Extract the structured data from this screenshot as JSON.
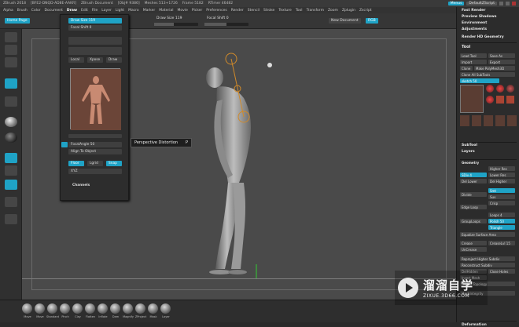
{
  "titlebar": {
    "items": [
      "ZBrush 2018",
      "[BFE2-DNQD-AD8E-AAKR]",
      "ZBrush Document",
      "[Obj# 9386]",
      "Meshes 513+1726",
      "Frame 5182",
      "RTimer 46482"
    ],
    "menus_btn": "Menus",
    "script_label": "DefaultZScript"
  },
  "menubar": {
    "items": [
      "Alpha",
      "Brush",
      "Color",
      "Document",
      "Draw",
      "Edit",
      "File",
      "Layer",
      "Light",
      "Macro",
      "Marker",
      "Material",
      "Movie",
      "Picker",
      "Preferences",
      "Render",
      "Stencil",
      "Stroke",
      "Texture",
      "Tool",
      "Transform",
      "Zoom",
      "Zplugin",
      "Zscript"
    ],
    "active": "Draw"
  },
  "topbar": {
    "home": "Home Page",
    "draw_size": "Draw Size 119",
    "focal_shift": "Focal Shift 0",
    "draw_size_2": "Draw Size 119",
    "focal_shift_2": "Focal Shift 0",
    "new_document": "New Document",
    "rgb_btn": "RGB"
  },
  "popup": {
    "draw_size": "Draw Size 119",
    "focal_shift": "Focal Shift 0",
    "xyz": "XYZ",
    "perspective_label": "Persp",
    "focal_angle": "FocalAngle 50",
    "align_to_object": "Align To Object",
    "floor": "Floor",
    "channels": "Channels",
    "buttons": [
      "Local",
      "Xpose",
      "Draw",
      "Lgrid",
      "Snap"
    ]
  },
  "tooltip": {
    "label": "Perspective Distortion",
    "shortcut": "P"
  },
  "rightpanel": {
    "sections": [
      "Fast Render",
      "Preview Shadows",
      "Environment",
      "Adjustments",
      "Render HD Geometry"
    ],
    "tool_title": "Tool",
    "load_tool": "Load Tool",
    "save_as": "Save As",
    "import": "Import",
    "export": "Export",
    "clone": "Clone",
    "make_polymesh": "Make PolyMesh3D",
    "clone_all": "Clone All SubTools",
    "sketch_label": "sketch 50",
    "subtool": "SubTool",
    "layers": "Layers",
    "geometry": "Geometry",
    "higher_res": "Higher Res",
    "lower_res": "Lower Res",
    "sdiv": "SDiv 4",
    "del_lower": "Del Lower",
    "del_higher": "Del Higher",
    "smt": "Smt",
    "suv": "Suv",
    "divide": "Divide",
    "crisp": "Crisp",
    "edge_loop": "Edge Loop",
    "loops": "Loops 4",
    "polish": "Polish 50",
    "grouploops": "GroupLoops",
    "triangle": "Triangle",
    "equalize": "Equalize Surface Area",
    "crease": "Crease",
    "crease_lvl": "CreaseLvl 15",
    "uncrease": "UnCrease",
    "reproject": "Reproject Higher Subdiv",
    "reconstruct": "Reconstruct Subdiv",
    "delhidden": "DelHidden",
    "close_holes": "Close Holes",
    "insert_mesh": "Insert Mesh",
    "mod_topology": "Modify Topology",
    "mesh_integrity": "MeshIntegrity",
    "deformation": "Deformation"
  },
  "brushes": [
    "Move",
    "Move",
    "Standard",
    "Pinch",
    "Clay",
    "Flatten",
    "Inflate",
    "Dam",
    "Magnify",
    "ZProject",
    "Mask",
    "Layer"
  ],
  "watermark": {
    "cn": "溜溜自学",
    "url": "ZIXUE.3D66.COM"
  },
  "colors": {
    "accent": "#1fa3c6",
    "panel": "#2c2c2c",
    "canvas": "#4a4a4a"
  }
}
